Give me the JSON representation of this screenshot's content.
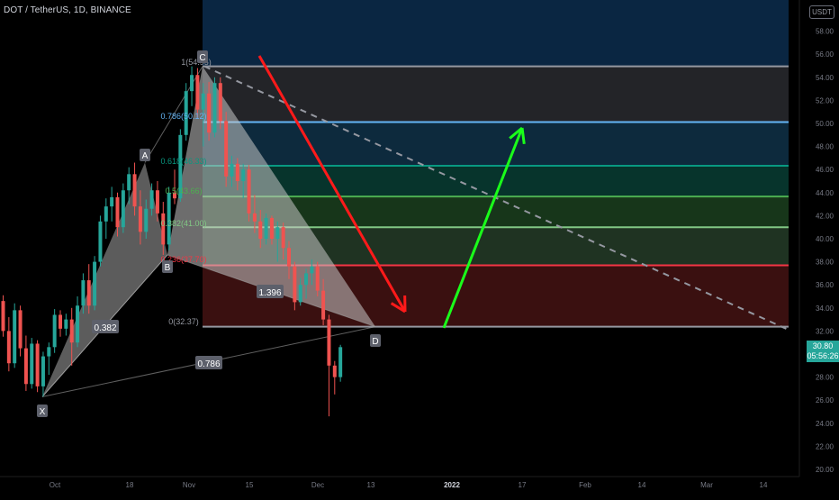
{
  "header": {
    "title": "DOT / TetherUS, 1D, BINANCE",
    "currency": "USDT"
  },
  "last_price": {
    "value": "30.80",
    "countdown": "05:56:26"
  },
  "chart_data": {
    "type": "candlestick",
    "symbol": "DOT / TetherUS",
    "interval": "1D",
    "exchange": "BINANCE",
    "ylim": [
      20,
      60
    ],
    "y_ticks": [
      "20.00",
      "22.00",
      "24.00",
      "26.00",
      "28.00",
      "30.00",
      "32.00",
      "34.00",
      "36.00",
      "38.00",
      "40.00",
      "42.00",
      "44.00",
      "46.00",
      "48.00",
      "50.00",
      "52.00",
      "54.00",
      "56.00",
      "58.00"
    ],
    "x_ticks": [
      "Oct",
      "18",
      "Nov",
      "15",
      "Dec",
      "13",
      "2022",
      "17",
      "Feb",
      "14",
      "Mar",
      "14"
    ],
    "candles": [
      {
        "o": 34.6,
        "h": 35.1,
        "l": 31.5,
        "c": 32.0
      },
      {
        "o": 32.0,
        "h": 33.2,
        "l": 28.5,
        "c": 29.2
      },
      {
        "o": 29.2,
        "h": 34.4,
        "l": 28.8,
        "c": 33.8
      },
      {
        "o": 33.8,
        "h": 34.2,
        "l": 29.8,
        "c": 30.5
      },
      {
        "o": 30.5,
        "h": 31.6,
        "l": 26.8,
        "c": 27.4
      },
      {
        "o": 27.4,
        "h": 31.4,
        "l": 27.0,
        "c": 30.9
      },
      {
        "o": 30.9,
        "h": 31.2,
        "l": 26.7,
        "c": 27.2
      },
      {
        "o": 27.2,
        "h": 30.2,
        "l": 26.3,
        "c": 29.8
      },
      {
        "o": 29.8,
        "h": 31.0,
        "l": 28.2,
        "c": 30.6
      },
      {
        "o": 30.6,
        "h": 33.9,
        "l": 30.1,
        "c": 33.4
      },
      {
        "o": 33.4,
        "h": 33.8,
        "l": 31.5,
        "c": 32.2
      },
      {
        "o": 32.2,
        "h": 33.5,
        "l": 31.6,
        "c": 33.0
      },
      {
        "o": 33.0,
        "h": 34.0,
        "l": 29.0,
        "c": 31.0
      },
      {
        "o": 31.0,
        "h": 35.0,
        "l": 30.6,
        "c": 34.2
      },
      {
        "o": 34.2,
        "h": 37.0,
        "l": 33.5,
        "c": 36.4
      },
      {
        "o": 36.4,
        "h": 37.8,
        "l": 33.5,
        "c": 34.2
      },
      {
        "o": 34.2,
        "h": 38.5,
        "l": 33.8,
        "c": 38.0
      },
      {
        "o": 38.0,
        "h": 42.0,
        "l": 37.6,
        "c": 41.5
      },
      {
        "o": 41.5,
        "h": 43.5,
        "l": 40.0,
        "c": 42.8
      },
      {
        "o": 42.8,
        "h": 44.5,
        "l": 41.5,
        "c": 43.6
      },
      {
        "o": 43.6,
        "h": 44.0,
        "l": 40.2,
        "c": 41.0
      },
      {
        "o": 41.0,
        "h": 44.8,
        "l": 40.5,
        "c": 44.2
      },
      {
        "o": 44.2,
        "h": 46.2,
        "l": 43.0,
        "c": 45.6
      },
      {
        "o": 45.6,
        "h": 46.6,
        "l": 42.0,
        "c": 42.8
      },
      {
        "o": 42.8,
        "h": 44.2,
        "l": 39.5,
        "c": 40.6
      },
      {
        "o": 40.6,
        "h": 43.4,
        "l": 40.0,
        "c": 42.6
      },
      {
        "o": 42.6,
        "h": 44.8,
        "l": 42.0,
        "c": 44.2
      },
      {
        "o": 44.2,
        "h": 45.0,
        "l": 41.5,
        "c": 42.2
      },
      {
        "o": 42.2,
        "h": 43.2,
        "l": 38.6,
        "c": 39.5
      },
      {
        "o": 39.5,
        "h": 44.5,
        "l": 39.0,
        "c": 44.0
      },
      {
        "o": 44.0,
        "h": 46.0,
        "l": 43.0,
        "c": 43.5
      },
      {
        "o": 43.5,
        "h": 49.5,
        "l": 43.2,
        "c": 49.0
      },
      {
        "o": 49.0,
        "h": 53.5,
        "l": 48.5,
        "c": 52.8
      },
      {
        "o": 52.8,
        "h": 54.95,
        "l": 51.5,
        "c": 54.2
      },
      {
        "o": 54.2,
        "h": 54.8,
        "l": 50.5,
        "c": 51.2
      },
      {
        "o": 51.2,
        "h": 53.5,
        "l": 48.0,
        "c": 52.6
      },
      {
        "o": 52.6,
        "h": 53.6,
        "l": 48.5,
        "c": 49.2
      },
      {
        "o": 49.2,
        "h": 54.0,
        "l": 48.8,
        "c": 53.5
      },
      {
        "o": 53.5,
        "h": 54.0,
        "l": 49.5,
        "c": 50.2
      },
      {
        "o": 50.2,
        "h": 51.0,
        "l": 44.5,
        "c": 45.4
      },
      {
        "o": 45.4,
        "h": 47.2,
        "l": 44.5,
        "c": 46.5
      },
      {
        "o": 46.5,
        "h": 47.0,
        "l": 44.2,
        "c": 45.0
      },
      {
        "o": 45.0,
        "h": 46.5,
        "l": 43.5,
        "c": 46.0
      },
      {
        "o": 46.0,
        "h": 46.4,
        "l": 41.5,
        "c": 42.2
      },
      {
        "o": 42.2,
        "h": 43.8,
        "l": 40.5,
        "c": 41.5
      },
      {
        "o": 41.5,
        "h": 42.5,
        "l": 39.2,
        "c": 40.0
      },
      {
        "o": 40.0,
        "h": 42.2,
        "l": 39.5,
        "c": 41.8
      },
      {
        "o": 41.8,
        "h": 42.0,
        "l": 39.5,
        "c": 40.0
      },
      {
        "o": 40.0,
        "h": 41.5,
        "l": 38.0,
        "c": 41.0
      },
      {
        "o": 41.0,
        "h": 41.4,
        "l": 38.2,
        "c": 39.2
      },
      {
        "o": 39.2,
        "h": 39.8,
        "l": 36.5,
        "c": 37.6
      },
      {
        "o": 37.6,
        "h": 38.0,
        "l": 33.8,
        "c": 34.5
      },
      {
        "o": 34.5,
        "h": 36.6,
        "l": 34.2,
        "c": 36.0
      },
      {
        "o": 36.0,
        "h": 37.4,
        "l": 34.8,
        "c": 37.0
      },
      {
        "o": 37.0,
        "h": 38.2,
        "l": 36.0,
        "c": 37.6
      },
      {
        "o": 37.6,
        "h": 38.0,
        "l": 35.0,
        "c": 35.5
      },
      {
        "o": 35.5,
        "h": 36.5,
        "l": 32.5,
        "c": 33.0
      },
      {
        "o": 33.0,
        "h": 33.4,
        "l": 24.6,
        "c": 29.0
      },
      {
        "o": 29.0,
        "h": 29.4,
        "l": 26.5,
        "c": 28.0
      },
      {
        "o": 28.0,
        "h": 30.8,
        "l": 27.6,
        "c": 30.6
      }
    ],
    "fibonacci": [
      {
        "label": "1(54.95)",
        "value": 54.95,
        "color": "#9598a1"
      },
      {
        "label": "0.786(50.12)",
        "value": 50.12,
        "color": "#64b5f6"
      },
      {
        "label": "0.618(46.33)",
        "value": 46.33,
        "color": "#089981"
      },
      {
        "label": "0.5(43.66)",
        "value": 43.66,
        "color": "#4caf50"
      },
      {
        "label": "0.382(41.00)",
        "value": 41.0,
        "color": "#81c784"
      },
      {
        "label": "0.236(37.70)",
        "value": 37.7,
        "color": "#f23645"
      },
      {
        "label": "0(32.37)",
        "value": 32.37,
        "color": "#9598a1"
      }
    ],
    "harmonic_points": [
      {
        "label": "X",
        "value": 26.3
      },
      {
        "label": "A",
        "value": 46.6
      },
      {
        "label": "B",
        "value": 38.6
      },
      {
        "label": "C",
        "value": 54.95
      },
      {
        "label": "D",
        "value": 32.37
      }
    ],
    "pattern_ratios": [
      "0.382",
      "0.786",
      "1.396"
    ],
    "colors": {
      "up": "#26a69a",
      "down": "#ef5350",
      "bearish_arrow": "#ff1a1a",
      "bullish_arrow": "#1aff1a"
    }
  }
}
